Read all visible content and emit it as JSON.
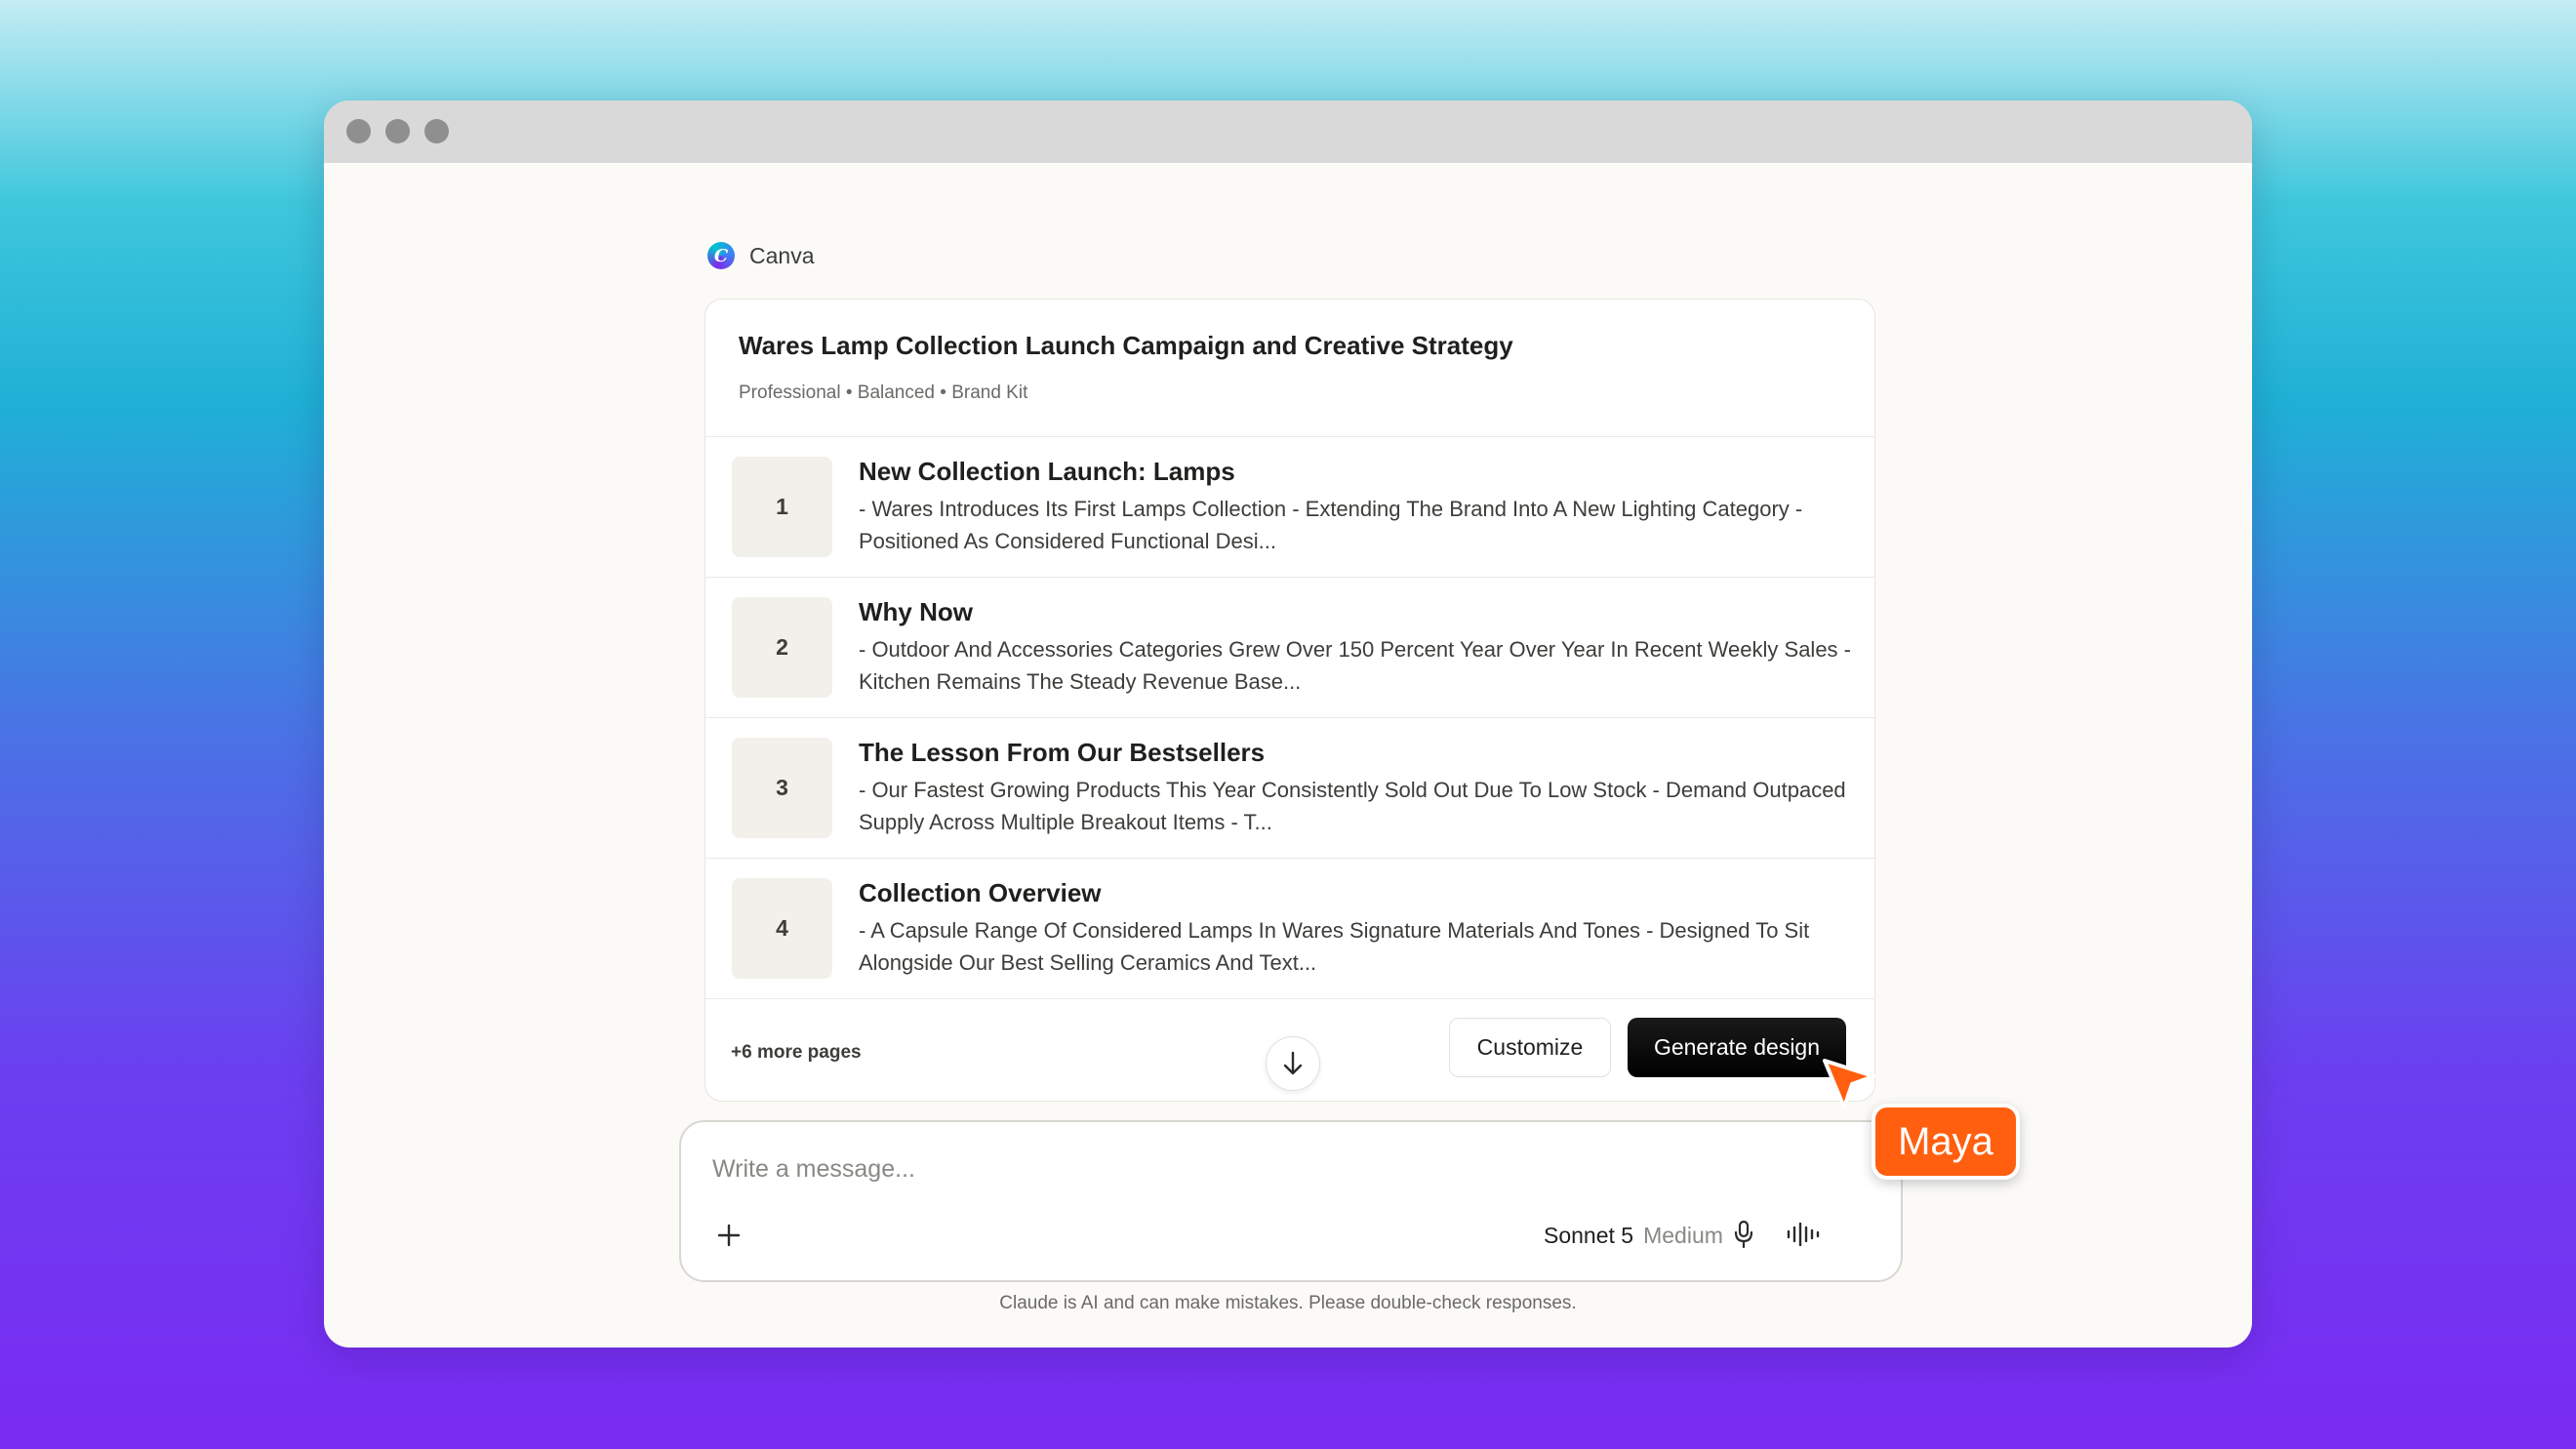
{
  "source": {
    "label": "Canva",
    "icon": "canva-logo-icon"
  },
  "card": {
    "title": "Wares Lamp Collection Launch Campaign and Creative Strategy",
    "tags": "Professional • Balanced • Brand Kit",
    "pages": [
      {
        "number": "1",
        "title": "New Collection Launch: Lamps",
        "description": "- Wares Introduces Its First Lamps Collection - Extending The Brand Into A New Lighting Category - Positioned As Considered Functional Desi..."
      },
      {
        "number": "2",
        "title": "Why Now",
        "description": "- Outdoor And Accessories Categories Grew Over 150 Percent Year Over Year In Recent Weekly Sales - Kitchen Remains The Steady Revenue Base..."
      },
      {
        "number": "3",
        "title": "The Lesson From Our Bestsellers",
        "description": "- Our Fastest Growing Products This Year Consistently Sold Out Due To Low Stock - Demand Outpaced Supply Across Multiple Breakout Items - T..."
      },
      {
        "number": "4",
        "title": "Collection Overview",
        "description": "- A Capsule Range Of Considered Lamps In Wares Signature Materials And Tones - Designed To Sit Alongside Our Best Selling Ceramics And Text..."
      }
    ],
    "more_pages": "+6 more pages",
    "customize_label": "Customize",
    "generate_label": "Generate design"
  },
  "composer": {
    "placeholder": "Write a message...",
    "value": "",
    "model_name": "Sonnet 5",
    "model_effort": "Medium"
  },
  "disclaimer": "Claude is AI and can make mistakes. Please double-check responses.",
  "cursor_label": "Maya",
  "colors": {
    "accent_orange": "#ff5f0f",
    "button_dark": "#000000",
    "window_bg": "#fbfaf7"
  }
}
